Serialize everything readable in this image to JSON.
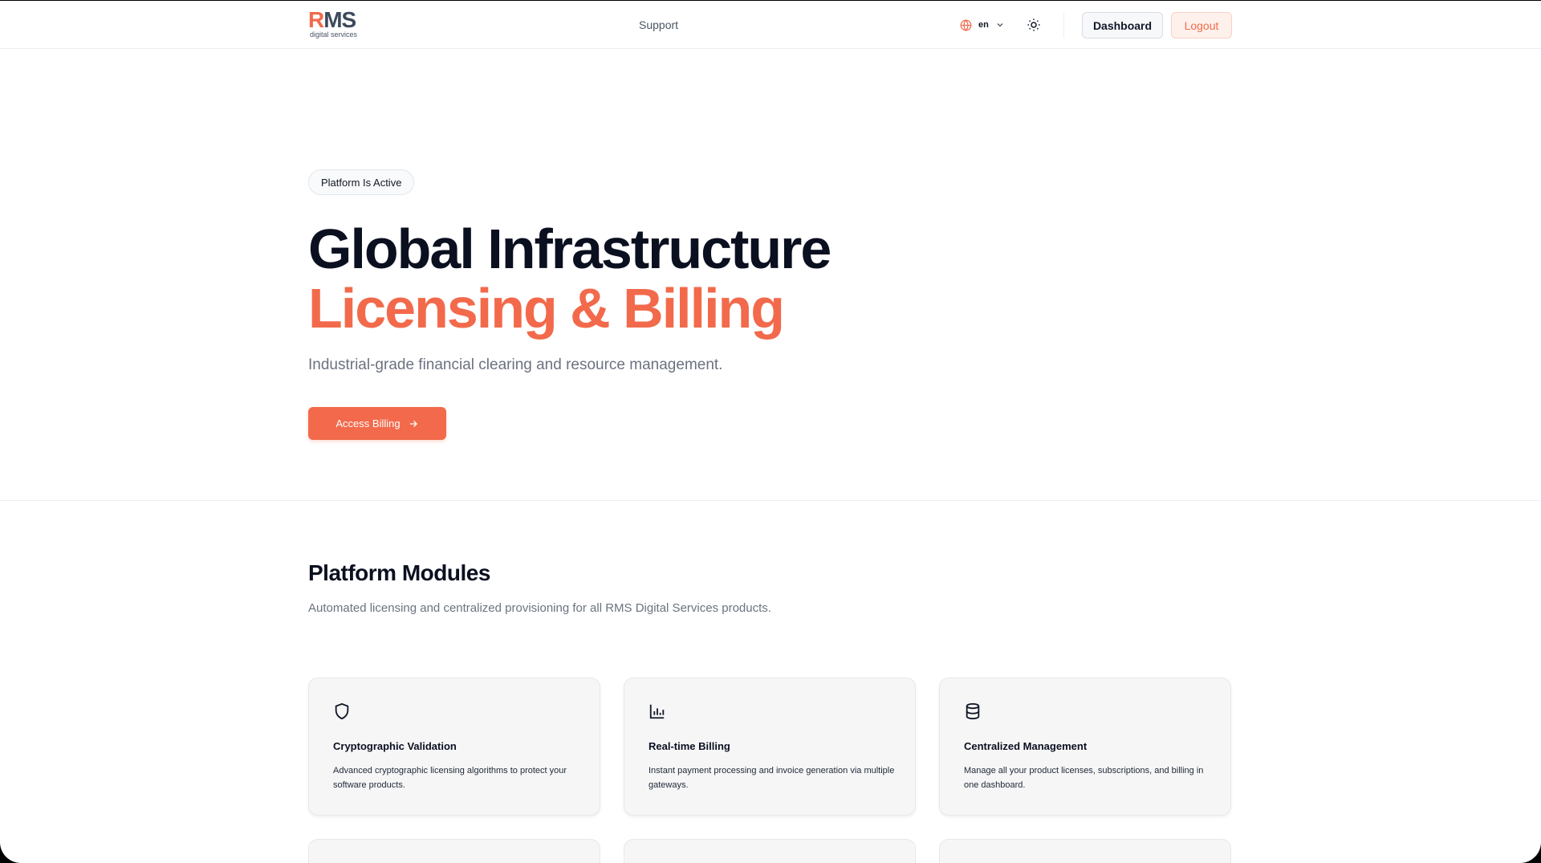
{
  "header": {
    "logo_main": "RMS",
    "logo_sub": "digital services",
    "nav_support": "Support",
    "language": "en",
    "dashboard_label": "Dashboard",
    "logout_label": "Logout"
  },
  "hero": {
    "badge": "Platform Is Active",
    "title_line1": "Global Infrastructure",
    "title_line2": "Licensing & Billing",
    "subtitle": "Industrial-grade financial clearing and resource management.",
    "cta_label": "Access Billing"
  },
  "modules": {
    "title": "Platform Modules",
    "subtitle": "Automated licensing and centralized provisioning for all RMS Digital Services products.",
    "cards": [
      {
        "icon": "shield-icon",
        "title": "Cryptographic Validation",
        "description": "Advanced cryptographic licensing algorithms to protect your software products."
      },
      {
        "icon": "bar-chart-icon",
        "title": "Real-time Billing",
        "description": "Instant payment processing and invoice generation via multiple gateways."
      },
      {
        "icon": "database-icon",
        "title": "Centralized Management",
        "description": "Manage all your product licenses, subscriptions, and billing in one dashboard."
      }
    ]
  },
  "colors": {
    "accent": "#f26a4b",
    "heading": "#0b1020",
    "muted": "#6b7280"
  }
}
